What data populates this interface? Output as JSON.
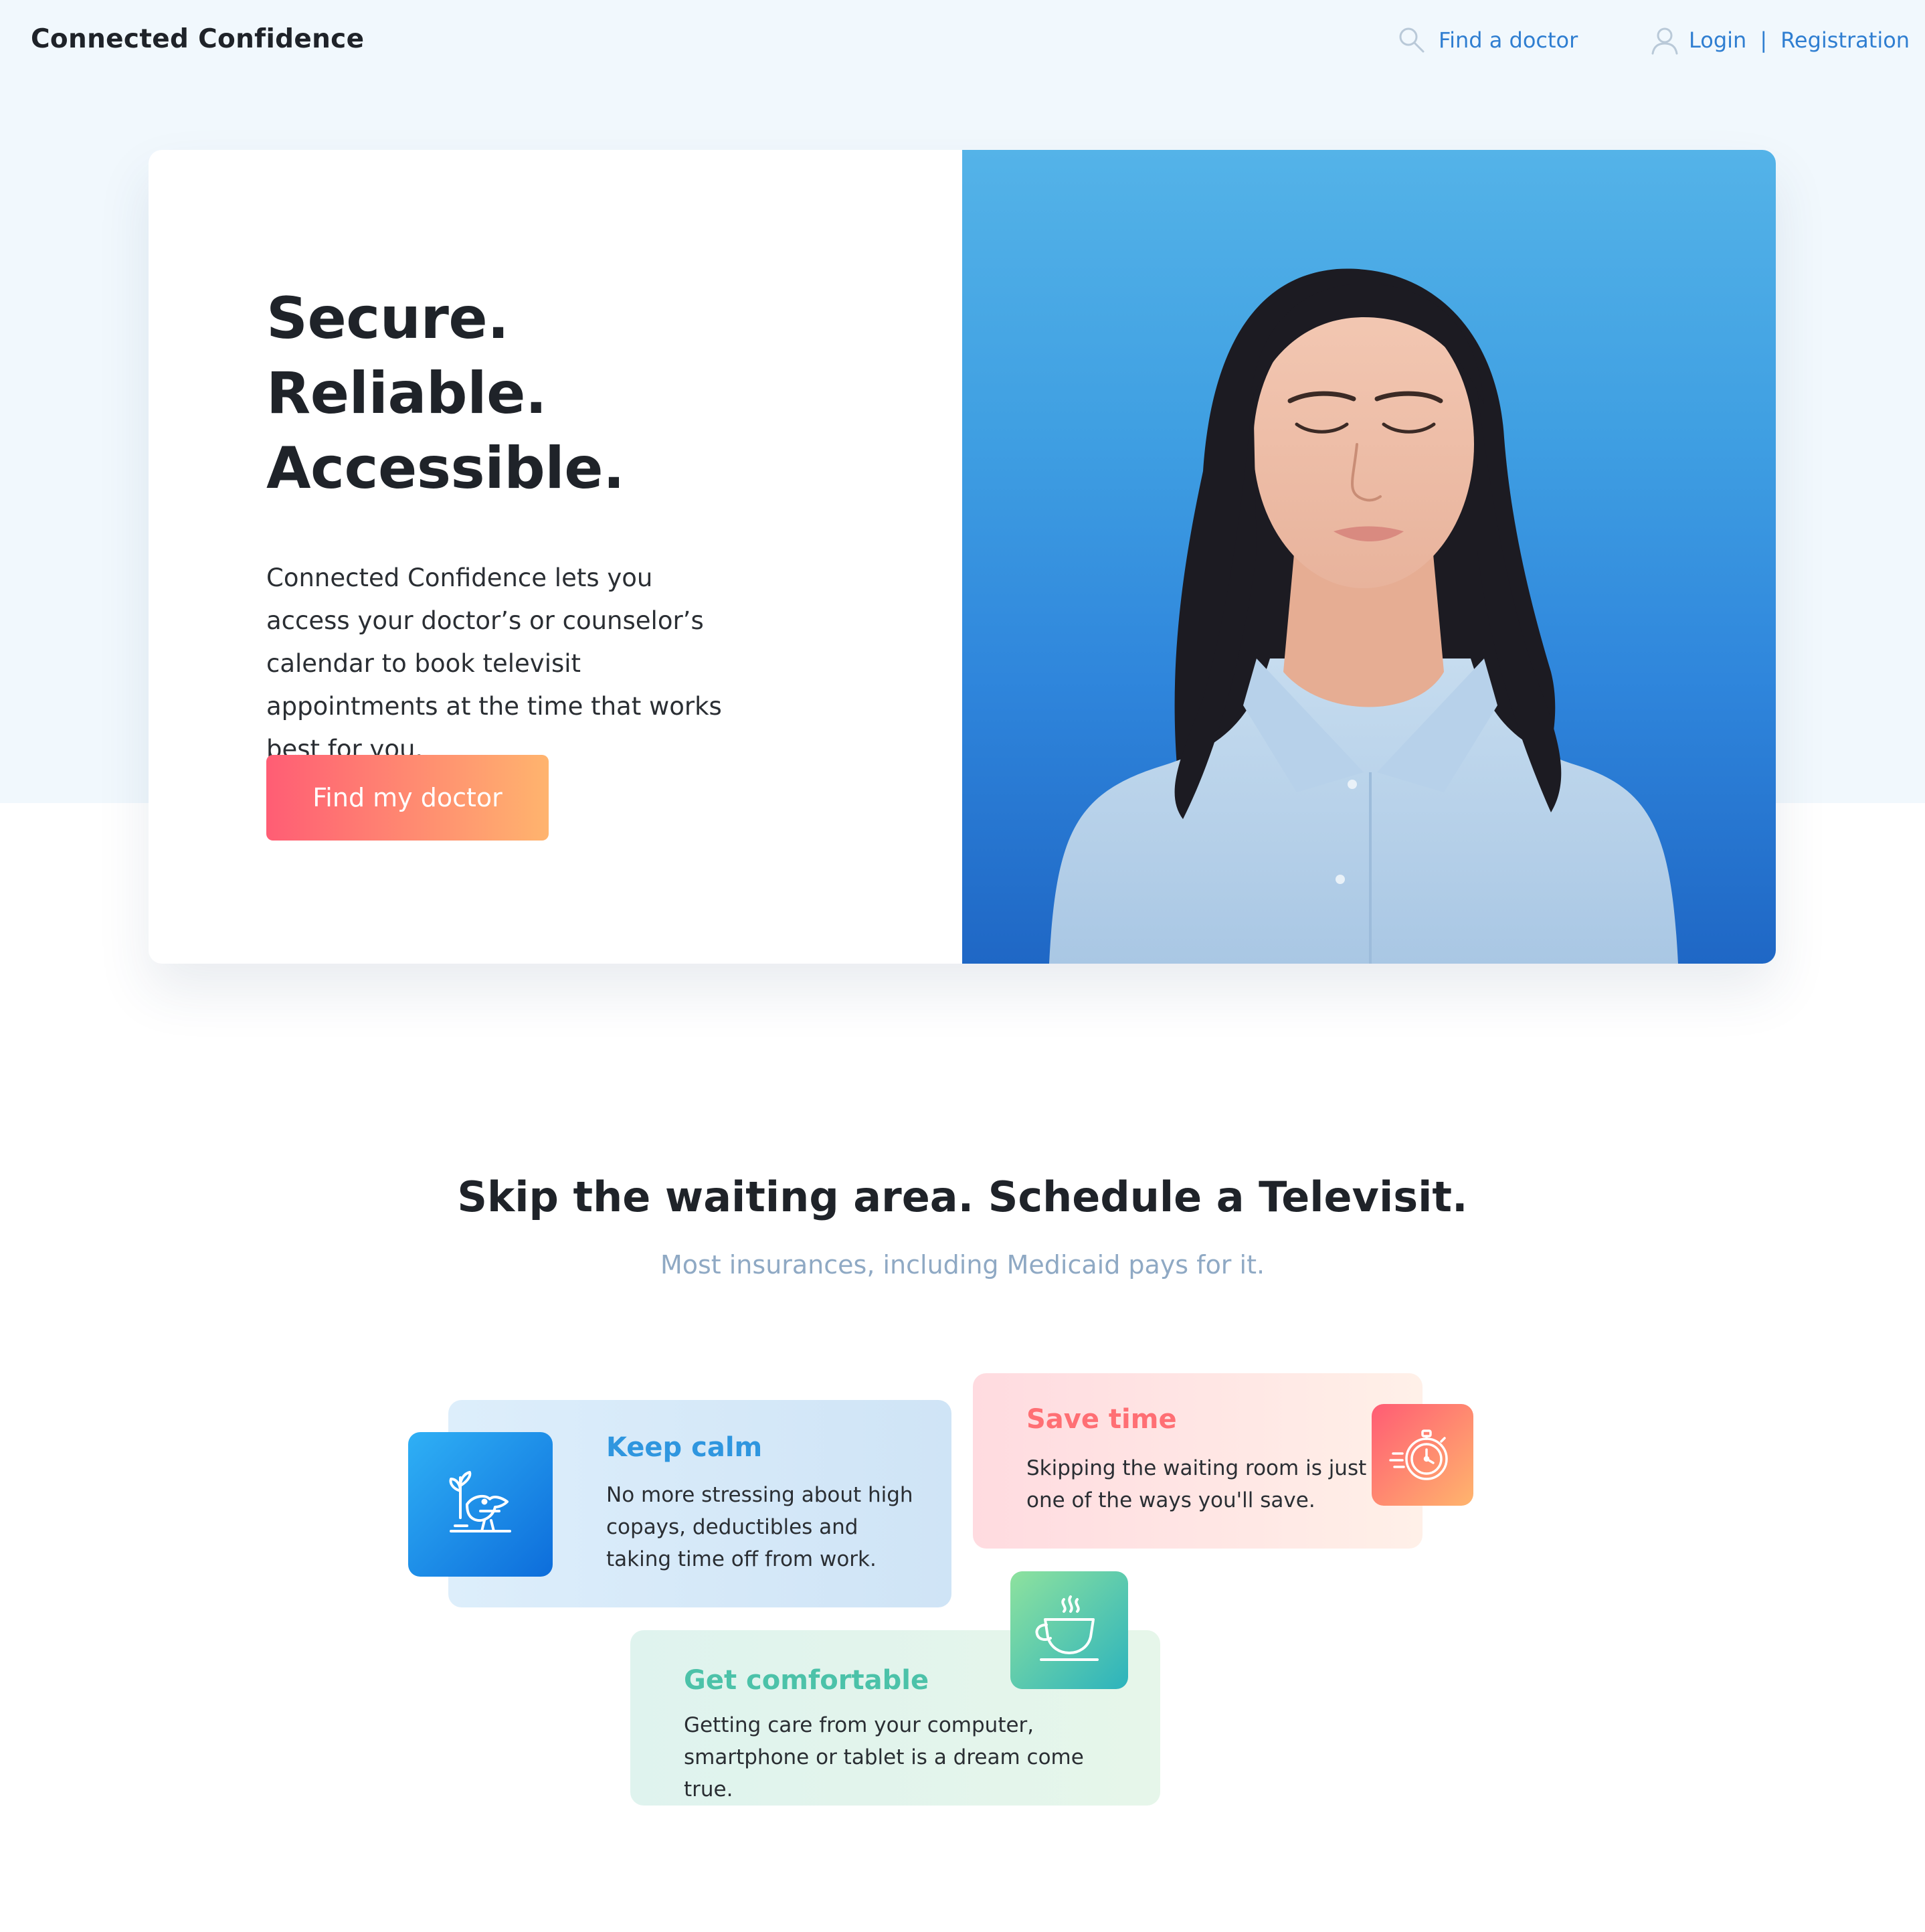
{
  "header": {
    "brand": "Connected Confidence",
    "find_doctor": "Find a doctor",
    "login": "Login",
    "separator": "|",
    "registration": "Registration",
    "search_icon": "search-icon",
    "user_icon": "user-icon",
    "link_color": "#2f7ed1"
  },
  "hero": {
    "title_line1": "Secure. Reliable.",
    "title_line2": "Accessible.",
    "description": "Connected Confidence lets you access your doctor’s or counselor’s calendar to book televisit appointments at the time that works best for you.",
    "cta": "Find my doctor",
    "cta_gradient": [
      "#ff5d74",
      "#ffb46e"
    ],
    "photo_background": "#3f9fe2"
  },
  "section": {
    "title": "Skip the waiting area. Schedule a Televisit.",
    "subtitle": "Most insurances, including Medicaid pays for it."
  },
  "features": [
    {
      "title": "Keep calm",
      "body": "No more stressing about high copays, deductibles and taking time off from work.",
      "icon": "bird-plant-icon",
      "accent": "#2f96df"
    },
    {
      "title": "Save time",
      "body": "Skipping the waiting room is just one of the ways you'll save.",
      "icon": "stopwatch-icon",
      "accent": "#ff6f74"
    },
    {
      "title": "Get comfortable",
      "body": "Getting care from your computer, smartphone or tablet is a dream come true.",
      "icon": "coffee-cup-icon",
      "accent": "#4cc2a9"
    }
  ]
}
